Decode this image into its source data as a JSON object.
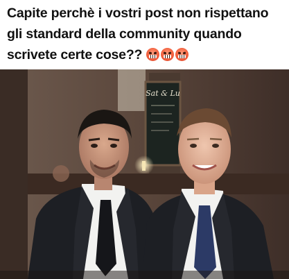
{
  "post": {
    "caption": "Capite perchè i vostri post non rispettano gli standard della community quando scrivete certe cose??",
    "emojis": [
      "face-with-symbols-on-mouth-icon",
      "face-with-symbols-on-mouth-icon",
      "face-with-symbols-on-mouth-icon"
    ]
  },
  "photo": {
    "sign_text": "Sat & Lu",
    "colors": {
      "wall": "#5e4a3f",
      "suit": "#1d1f24",
      "shirt": "#f2f2f0",
      "tie_left": "#15161a",
      "tie_right": "#2c3a66"
    }
  }
}
